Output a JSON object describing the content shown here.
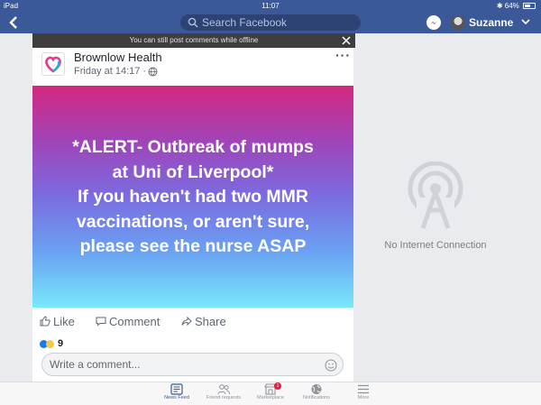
{
  "status_bar": {
    "device": "iPad",
    "time": "11:07",
    "battery": "64%",
    "battery_level": 0.64
  },
  "header": {
    "search_placeholder": "Search Facebook",
    "username": "Suzanne"
  },
  "offline_banner": {
    "text": "You can still post comments while offline"
  },
  "post": {
    "page_name": "Brownlow Health",
    "timestamp": "Friday at 14:17 ·",
    "image_text": [
      "*ALERT- Outbreak of mumps",
      "at Uni of Liverpool*",
      "If you haven't had two MMR",
      "vaccinations, or aren't sure,",
      "please see the nurse ASAP"
    ],
    "actions": {
      "like": "Like",
      "comment": "Comment",
      "share": "Share"
    },
    "reaction_count": "9",
    "comment_placeholder": "Write a comment..."
  },
  "offline_panel": {
    "message": "No Internet Connection"
  },
  "tabbar": {
    "items": [
      {
        "label": "News Feed",
        "icon": "news-feed-icon",
        "active": true
      },
      {
        "label": "Friend requests",
        "icon": "friends-icon",
        "active": false
      },
      {
        "label": "Marketplace",
        "icon": "marketplace-icon",
        "active": false,
        "badge": "1"
      },
      {
        "label": "Notifications",
        "icon": "globe-icon",
        "active": false
      },
      {
        "label": "More",
        "icon": "menu-icon",
        "active": false
      }
    ]
  },
  "colors": {
    "brand": "#3b5998",
    "gradient_top": "#d4287f",
    "gradient_bottom": "#78e8fb",
    "badge": "#e41e3f"
  }
}
